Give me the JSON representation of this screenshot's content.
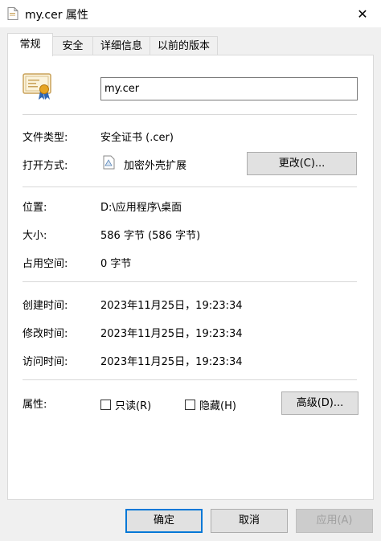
{
  "window": {
    "title": "my.cer 属性",
    "close_glyph": "✕"
  },
  "tabs": [
    {
      "label": "常规",
      "active": true
    },
    {
      "label": "安全",
      "active": false
    },
    {
      "label": "详细信息",
      "active": false
    },
    {
      "label": "以前的版本",
      "active": false
    }
  ],
  "general": {
    "file_name": "my.cer",
    "file_type_label": "文件类型:",
    "file_type_value": "安全证书 (.cer)",
    "open_with_label": "打开方式:",
    "open_with_value": "加密外壳扩展",
    "change_button": "更改(C)...",
    "location_label": "位置:",
    "location_value": "D:\\应用程序\\桌面",
    "size_label": "大小:",
    "size_value": "586 字节 (586 字节)",
    "size_on_disk_label": "占用空间:",
    "size_on_disk_value": "0 字节",
    "created_label": "创建时间:",
    "created_value": "2023年11月25日，19:23:34",
    "modified_label": "修改时间:",
    "modified_value": "2023年11月25日，19:23:34",
    "accessed_label": "访问时间:",
    "accessed_value": "2023年11月25日，19:23:34",
    "attributes_label": "属性:",
    "readonly_label": "只读(R)",
    "hidden_label": "隐藏(H)",
    "advanced_button": "高级(D)..."
  },
  "footer": {
    "ok": "确定",
    "cancel": "取消",
    "apply": "应用(A)"
  },
  "colors": {
    "accent": "#0078d7",
    "panel": "#ffffff",
    "dialog": "#f0f0f0"
  }
}
